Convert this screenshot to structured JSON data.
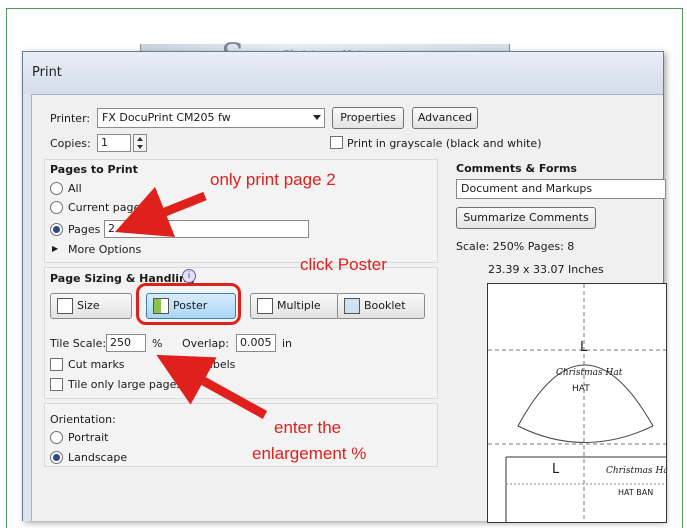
{
  "window": {
    "title": "Print"
  },
  "background": {
    "watermark_letter": "S",
    "watermark_text": "Christmas Hat"
  },
  "printer": {
    "label": "Printer:",
    "value": "FX DocuPrint CM205 fw",
    "properties_label": "Properties",
    "advanced_label": "Advanced"
  },
  "copies": {
    "label": "Copies:",
    "value": "1"
  },
  "grayscale": {
    "label": "Print in grayscale (black and white)",
    "checked": false
  },
  "pages_to_print": {
    "heading": "Pages to Print",
    "options": [
      {
        "label": "All",
        "selected": false
      },
      {
        "label": "Current page",
        "selected": false
      },
      {
        "label": "Pages",
        "selected": true
      }
    ],
    "pages_value": "2",
    "more_options_label": "More Options"
  },
  "sizing": {
    "heading": "Page Sizing & Handling",
    "buttons": [
      {
        "label": "Size",
        "active": false
      },
      {
        "label": "Poster",
        "active": true
      },
      {
        "label": "Multiple",
        "active": false
      },
      {
        "label": "Booklet",
        "active": false
      }
    ],
    "tile_scale_label": "Tile Scale:",
    "tile_scale_value": "250",
    "percent_unit": "%",
    "overlap_label": "Overlap:",
    "overlap_value": "0.005",
    "overlap_unit": "in",
    "cut_marks_label": "Cut marks",
    "labels_label": "Labels",
    "tile_large_label": "Tile only large pages"
  },
  "orientation": {
    "heading": "Orientation:",
    "options": [
      {
        "label": "Portrait",
        "selected": false
      },
      {
        "label": "Landscape",
        "selected": true
      }
    ]
  },
  "comments": {
    "heading": "Comments & Forms",
    "value": "Document and Markups",
    "summarize_label": "Summarize Comments",
    "scale_text": "Scale: 250% Pages: 8",
    "size_text": "23.39 x 33.07 Inches"
  },
  "preview": {
    "script_text": "Christmas Hat",
    "hat_label": "HAT",
    "letter": "L",
    "hat_band_label": "HAT BAN"
  },
  "annotations": {
    "only_print": "only print page 2",
    "click_poster": "click Poster",
    "enter_line1": "enter the",
    "enter_line2": "enlargement %",
    "color": "#e0201c"
  }
}
